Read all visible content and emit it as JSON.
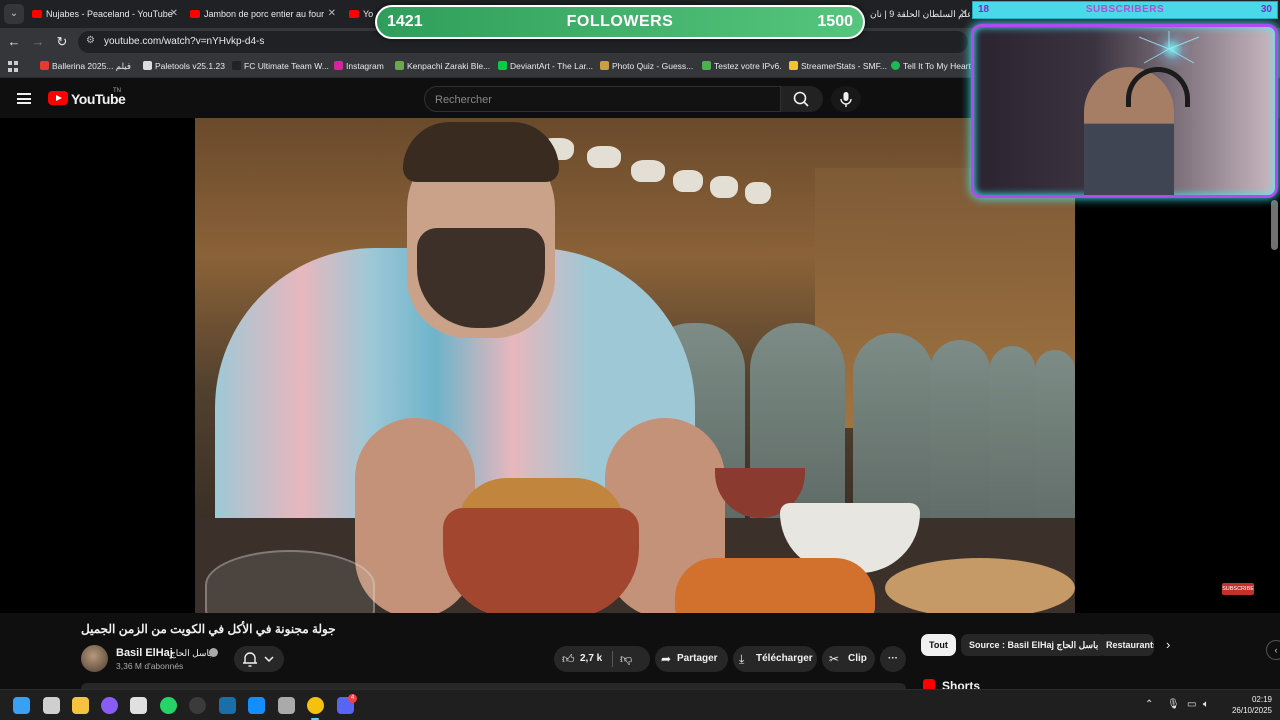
{
  "browser": {
    "tabs": [
      {
        "label": "Nujabes - Peaceland - YouTube"
      },
      {
        "label": "Jambon de porc entier au four"
      },
      {
        "label": "Yo"
      },
      {
        "label": "علم السلطان الحلقة 9 | نان"
      }
    ],
    "url": "youtube.com/watch?v=nYHvkp-d4-s",
    "bookmarks": [
      {
        "label": "Ballerina 2025... فيلم",
        "color": "#e53935"
      },
      {
        "label": "Paletools v25.1.23",
        "color": "#dddddd"
      },
      {
        "label": "FC Ultimate Team W...",
        "color": "#222222"
      },
      {
        "label": "Instagram",
        "color": "#d6249f"
      },
      {
        "label": "Kenpachi Zaraki Ble...",
        "color": "#6aa84f"
      },
      {
        "label": "DeviantArt - The Lar...",
        "color": "#05cc47"
      },
      {
        "label": "Photo Quiz - Guess...",
        "color": "#c8a040"
      },
      {
        "label": "Testez votre IPv6.",
        "color": "#4caf50"
      },
      {
        "label": "StreamerStats - SMF...",
        "color": "#f4c430"
      },
      {
        "label": "Tell It To My Heart",
        "color": "#1db954"
      }
    ]
  },
  "youtube": {
    "logo_text": "YouTube",
    "country_code": "TN",
    "search_placeholder": "Rechercher"
  },
  "video": {
    "title": "جولة مجنونة في الأكل في الكويت من الزمن الجميل",
    "channel_name": "Basil ElHaj",
    "channel_name_ar": "باسل الحاج",
    "subscribers": "3,36 M d'abonnés",
    "likes": "2,7 k",
    "share_label": "Partager",
    "download_label": "Télécharger",
    "clip_label": "Clip",
    "in_video_subscribe": "SUBSCRIBE"
  },
  "sidebar": {
    "chips": [
      {
        "label": "Tout"
      },
      {
        "label": "Source : Basil ElHaj باسل الحاج"
      },
      {
        "label": "Restaurants"
      }
    ],
    "shorts_label": "Shorts"
  },
  "overlays": {
    "followers": {
      "current": "1421",
      "label": "FOLLOWERS",
      "goal": "1500"
    },
    "subscribers": {
      "current": "18",
      "label": "SUBSCRIBERS",
      "goal": "30"
    }
  },
  "taskbar": {
    "time": "02:19",
    "date": "26/10/2025",
    "discord_badge": "4",
    "icons": [
      {
        "name": "windows-start-icon",
        "color": "#3aa0f3"
      },
      {
        "name": "task-view-icon",
        "color": "#cfcfcf"
      },
      {
        "name": "file-explorer-icon",
        "color": "#f6c340"
      },
      {
        "name": "cortana-icon",
        "color": "#8a5cf6"
      },
      {
        "name": "snipping-tool-icon",
        "color": "#e0e0e0"
      },
      {
        "name": "whatsapp-icon",
        "color": "#25d366"
      },
      {
        "name": "obs-icon",
        "color": "#3b3b3b"
      },
      {
        "name": "steam-icon",
        "color": "#1b6fa8"
      },
      {
        "name": "battlenet-icon",
        "color": "#148eff"
      },
      {
        "name": "app-icon",
        "color": "#aaaaaa"
      },
      {
        "name": "chrome-icon",
        "color": "#f4c20d"
      },
      {
        "name": "discord-icon",
        "color": "#5865f2"
      }
    ]
  }
}
